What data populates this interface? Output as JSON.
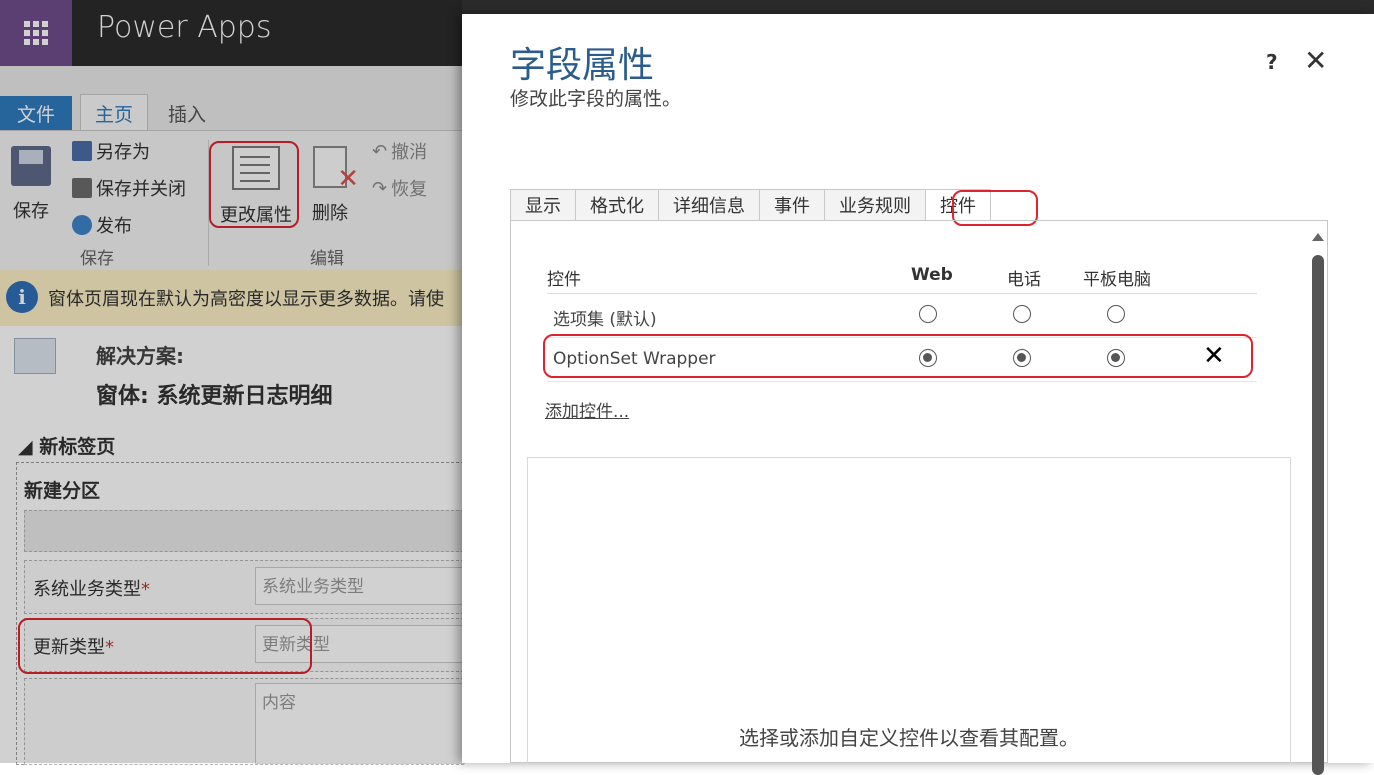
{
  "app": {
    "name": "Power Apps"
  },
  "ribbon": {
    "tabs": {
      "file": "文件",
      "home": "主页",
      "insert": "插入"
    },
    "save": "保存",
    "save_as": "另存为",
    "save_close": "保存并关闭",
    "publish": "发布",
    "group_save": "保存",
    "change_properties": "更改属性",
    "delete": "删除",
    "undo": "撤消",
    "redo": "恢复",
    "group_edit": "编辑"
  },
  "notice": {
    "text": "窗体页眉现在默认为高密度以显示更多数据。请使"
  },
  "form": {
    "solution_label": "解决方案:",
    "form_label": "窗体: 系统更新日志明细",
    "tab_title": "新标签页",
    "section_title": "新建分区",
    "fields": [
      {
        "label": "系统业务类型",
        "required": "*",
        "placeholder": "系统业务类型"
      },
      {
        "label": "更新类型",
        "required": "*",
        "placeholder": "更新类型"
      },
      {
        "label": "",
        "required": "",
        "placeholder": "内容"
      }
    ]
  },
  "dialog": {
    "title": "字段属性",
    "subtitle": "修改此字段的属性。",
    "help": "?",
    "close": "✕",
    "tabs": [
      "显示",
      "格式化",
      "详细信息",
      "事件",
      "业务规则",
      "控件"
    ],
    "active_tab": "控件",
    "table": {
      "headers": {
        "control": "控件",
        "web": "Web",
        "phone": "电话",
        "tablet": "平板电脑"
      },
      "rows": [
        {
          "name": "选项集 (默认)",
          "web": false,
          "phone": false,
          "tablet": false,
          "removable": false
        },
        {
          "name": "OptionSet Wrapper",
          "web": true,
          "phone": true,
          "tablet": true,
          "removable": true
        }
      ],
      "remove_symbol": "✕"
    },
    "add_control": "添加控件...",
    "config_hint": "选择或添加自定义控件以查看其配置。"
  },
  "colors": {
    "accent": "#2f7bbf",
    "highlight": "#e0242f",
    "waffle": "#6f4e8c"
  }
}
